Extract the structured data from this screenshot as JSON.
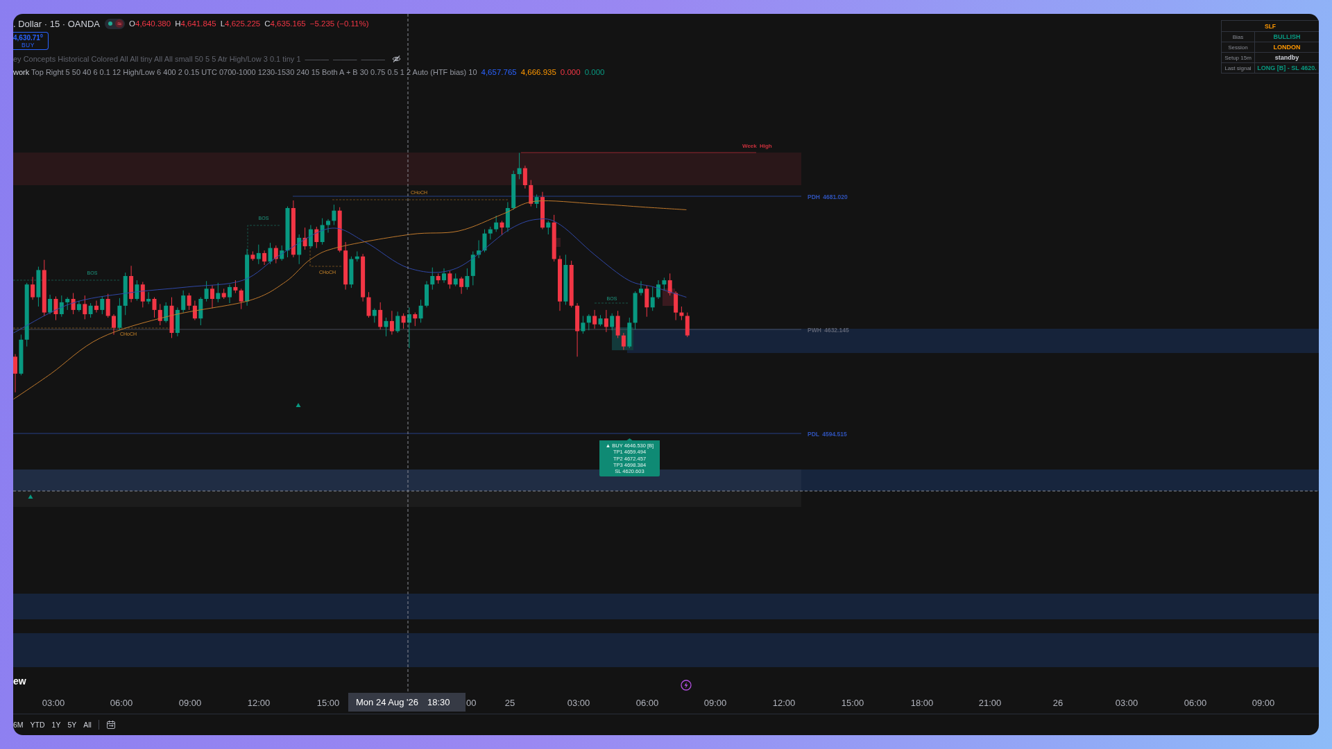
{
  "header": {
    "title": ". Dollar · 15 · OANDA",
    "status_badge": "≈",
    "ohlc": [
      {
        "label": "O",
        "value": "4,640.380"
      },
      {
        "label": "H",
        "value": "4,641.845"
      },
      {
        "label": "L",
        "value": "4,625.225"
      },
      {
        "label": "C",
        "value": "4,635.165"
      }
    ],
    "change": "−5.235 (−0.11%)"
  },
  "trade_button": {
    "price": "4,630.71$^{0}$",
    "label": "BUY"
  },
  "indicators": [
    {
      "name": "ey Concepts",
      "params": "Historical Colored All All tiny All All small 50 5 5 Atr High/Low 3 0.1 tiny 1",
      "hidden": true,
      "values": [
        {
          "text": "———"
        },
        {
          "text": "———"
        },
        {
          "text": "———"
        }
      ]
    },
    {
      "name": "work",
      "params": "Top Right 5 50 40 6 0.1 12 High/Low 6 400 2 0.15 UTC 0700-1000 1230-1530 240 15 Both A + B 30 0.75 0.5 1 2 Auto (HTF bias) 10",
      "hidden": false,
      "values": [
        {
          "text": "4,657.765",
          "color": "#2962ff"
        },
        {
          "text": "4,666.935",
          "color": "#ff9800"
        },
        {
          "text": "0.000",
          "color": "#f23645"
        },
        {
          "text": "0.000",
          "color": "#089981"
        }
      ]
    }
  ],
  "signal_table": {
    "title": "SLF",
    "rows": [
      {
        "label": "Bias",
        "value": "BULLISH",
        "color": "#089981"
      },
      {
        "label": "Session",
        "value": "LONDON",
        "color": "#ff9800"
      },
      {
        "label": "Setup 15m",
        "value": "standby",
        "color": "#d1d4dc"
      },
      {
        "label": "Last signal",
        "value": "LONG [B] - SL 4620.",
        "color": "#089981"
      }
    ]
  },
  "chart": {
    "levels": [
      {
        "label": "Week High",
        "color": "#c8303c"
      },
      {
        "label": "PDH 4681.020",
        "color": "#2f52b8"
      },
      {
        "label": "PWH 4632.145",
        "color": "#5d6272"
      },
      {
        "label": "PDL 4594.515",
        "color": "#2f52b8"
      }
    ],
    "structure_labels": [
      {
        "text": "CHoCH",
        "kind": "choch"
      },
      {
        "text": "BOS",
        "kind": "bos"
      },
      {
        "text": "CHoCH",
        "kind": "choch"
      },
      {
        "text": "BOS",
        "kind": "bos"
      },
      {
        "text": "BOS",
        "kind": "bos"
      },
      {
        "text": "CHoCH",
        "kind": "choch"
      }
    ],
    "signal_callout": {
      "lines": [
        "▲ BUY 4646.530 [B]",
        "TP1 4659.494",
        "TP2 4672.457",
        "TP3 4698.384",
        "SL 4620.603"
      ]
    }
  },
  "pane_title": "ew",
  "time_axis": {
    "ticks": [
      "03:00",
      "06:00",
      "09:00",
      "12:00",
      "15:00",
      "00",
      "25",
      "03:00",
      "06:00",
      "09:00",
      "12:00",
      "15:00",
      "18:00",
      "21:00",
      "26",
      "03:00",
      "06:00",
      "09:00"
    ],
    "crosshair": {
      "date": "Mon 24 Aug '26",
      "time": "18:30"
    }
  },
  "range_toolbar": [
    {
      "label": "6M",
      "selected": false
    },
    {
      "label": "YTD",
      "selected": false
    },
    {
      "label": "1Y",
      "selected": false
    },
    {
      "label": "5Y",
      "selected": false
    },
    {
      "label": "All",
      "selected": false
    }
  ]
}
